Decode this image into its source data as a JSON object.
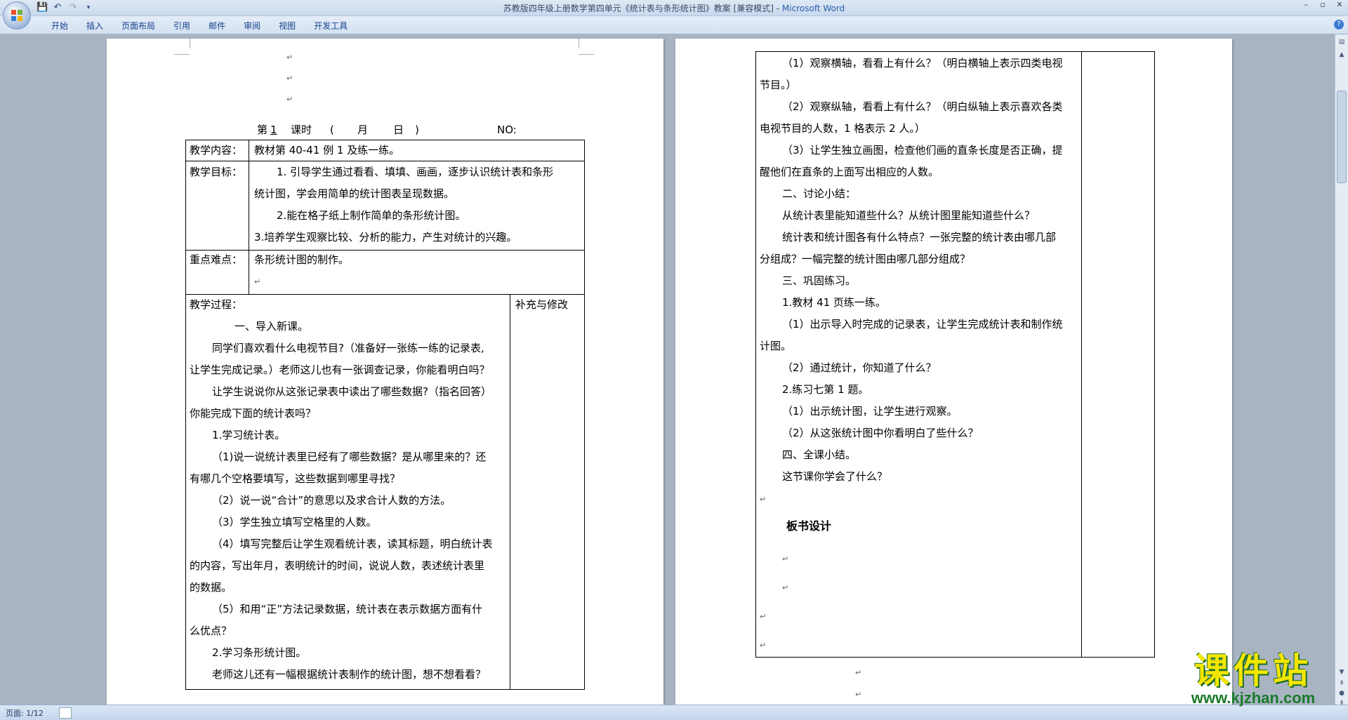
{
  "window": {
    "title_doc": "苏教版四年级上册数学第四单元《统计表与条形统计图》教案 [兼容模式] - ",
    "title_app": "Microsoft Word",
    "controls": [
      "–",
      "▫",
      "✕"
    ]
  },
  "ribbon": {
    "tabs": [
      "开始",
      "插入",
      "页面布局",
      "引用",
      "邮件",
      "审阅",
      "视图",
      "开发工具"
    ],
    "help": "?"
  },
  "left_page": {
    "header_line": {
      "di": "第",
      "lesson_no": "1",
      "keshi": "课时",
      "open_paren": "(",
      "month": "月",
      "day": "日",
      "close_paren": ")",
      "no_label": "NO:"
    },
    "rows": {
      "content_label": "教学内容：",
      "content_value": "教材第 40-41 例 1 及练一练。",
      "goal_label": "教学目标：",
      "goal_1a": "1. 引导学生通过看看、填填、画画，逐步认识统计表和条形",
      "goal_1b": "统计图，学会用简单的统计图表呈现数据。",
      "goal_2": "2.能在格子纸上制作简单的条形统计图。",
      "goal_3": "3.培养学生观察比较、分析的能力，产生对统计的兴趣。",
      "key_label": "重点难点：",
      "key_value": "条形统计图的制作。",
      "process_label": "教学过程：",
      "supplement_label": "补充与修改"
    },
    "process_lines": [
      "一、导入新课。",
      "同学们喜欢看什么电视节目?（准备好一张练一练的记录表,",
      "让学生完成记录。）老师这儿也有一张调查记录，你能看明白吗？",
      "让学生说说你从这张记录表中读出了哪些数据?（指名回答）",
      "你能完成下面的统计表吗？",
      "1.学习统计表。",
      "（1)说一说统计表里已经有了哪些数据？是从哪里来的？还",
      "有哪几个空格要填写，这些数据到哪里寻找？",
      "（2）说一说“合计”的意思以及求合计人数的方法。",
      "（3）学生独立填写空格里的人数。",
      "（4）填写完整后让学生观看统计表，读其标题，明白统计表",
      "的内容，写出年月，表明统计的时间，说说人数，表述统计表里",
      "的数据。",
      "（5）和用“正”方法记录数据，统计表在表示数据方面有什",
      "么优点？",
      "2.学习条形统计图。",
      "老师这儿还有一幅根据统计表制作的统计图，想不想看看？"
    ]
  },
  "right_page": {
    "lines": [
      "（1）观察横轴，看看上有什么？（明白横轴上表示四类电视",
      "节目。）",
      "（2）观察纵轴，看看上有什么？（明白纵轴上表示喜欢各类",
      "电视节目的人数，1 格表示 2 人。）",
      "（3）让学生独立画图，检查他们画的直条长度是否正确，提",
      "醒他们在直条的上面写出相应的人数。",
      "二、讨论小结：",
      "从统计表里能知道些什么？从统计图里能知道些什么？",
      "统计表和统计图各有什么特点？一张完整的统计表由哪几部",
      "分组成？一幅完整的统计图由哪几部分组成？",
      "三、巩固练习。",
      "1.教材 41 页练一练。",
      "（1）出示导入时完成的记录表，让学生完成统计表和制作统",
      "计图。",
      "（2）通过统计，你知道了什么？",
      "2.练习七第 1 题。",
      "（1）出示统计图，让学生进行观察。",
      "（2）从这张统计图中你看明白了些什么？",
      "四、全课小结。",
      "这节课你学会了什么？"
    ],
    "board_title": "板书设计"
  },
  "statusbar": {
    "page_info": "页面: 1/12"
  },
  "watermark": {
    "cn": "课件站",
    "url": "www.kjzhan.com"
  },
  "para_mark": "↵"
}
